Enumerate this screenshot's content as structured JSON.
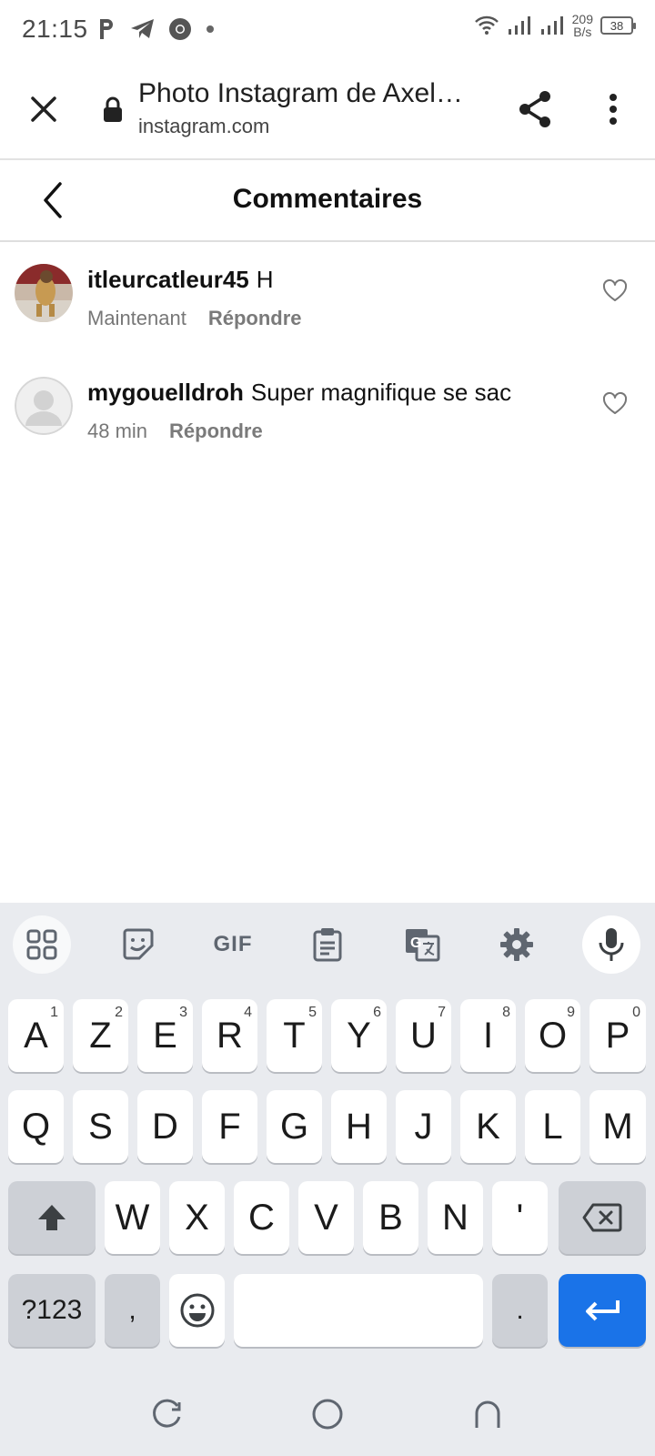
{
  "status_bar": {
    "time": "21:15",
    "speed_value": "209",
    "speed_unit": "B/s",
    "battery": "38"
  },
  "browser": {
    "page_title": "Photo Instagram de Axel…",
    "domain": "instagram.com"
  },
  "comments_header": {
    "title": "Commentaires"
  },
  "comments": [
    {
      "username": "itleurcatleur45",
      "text": "H",
      "time": "Maintenant",
      "reply_label": "Répondre"
    },
    {
      "username": "mygouelldroh",
      "text": "Super magnifique se sac",
      "time": "48 min",
      "reply_label": "Répondre"
    }
  ],
  "keyboard": {
    "toolbar": {
      "gif_label": "GIF"
    },
    "row1": [
      {
        "label": "A",
        "hint": "1"
      },
      {
        "label": "Z",
        "hint": "2"
      },
      {
        "label": "E",
        "hint": "3"
      },
      {
        "label": "R",
        "hint": "4"
      },
      {
        "label": "T",
        "hint": "5"
      },
      {
        "label": "Y",
        "hint": "6"
      },
      {
        "label": "U",
        "hint": "7"
      },
      {
        "label": "I",
        "hint": "8"
      },
      {
        "label": "O",
        "hint": "9"
      },
      {
        "label": "P",
        "hint": "0"
      }
    ],
    "row2": [
      "Q",
      "S",
      "D",
      "F",
      "G",
      "H",
      "J",
      "K",
      "L",
      "M"
    ],
    "row3": [
      "W",
      "X",
      "C",
      "V",
      "B",
      "N",
      "'"
    ],
    "row4": {
      "symbols": "?123",
      "comma": ",",
      "period": "."
    }
  },
  "icons": {
    "status_left": [
      "parking-icon",
      "telegram-icon",
      "chrome-icon",
      "dot-icon"
    ],
    "status_right": [
      "wifi-icon",
      "signal-icon",
      "signal-icon",
      "battery-icon"
    ],
    "accent_blue": "#1a73e8"
  }
}
